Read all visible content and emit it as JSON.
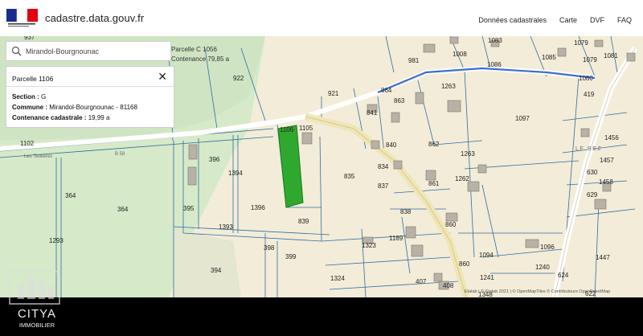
{
  "header": {
    "brand": "cadastre.data.gouv.fr",
    "nav": [
      "Données cadastrales",
      "Carte",
      "DVF",
      "FAQ"
    ]
  },
  "search": {
    "value": "Mirandol-Bourgnounac"
  },
  "tooltip": {
    "line1": "Parcelle C 1056",
    "line2": "Contenance 79,85 a"
  },
  "parcel_panel": {
    "title": "Parcelle 1106",
    "section_label": "Section :",
    "section_value": "G",
    "commune_label": "Commune :",
    "commune_value": "Mirandol-Bourgnounac - 81168",
    "contenance_label": "Contenance cadastrale :",
    "contenance_value": "19,99 a"
  },
  "map": {
    "highlight_color": "#2fa82f",
    "road_labels": [
      "B 58",
      "Les Teulières"
    ],
    "place_label": "LE BEZ",
    "parcel_numbers": [
      "937",
      "981",
      "1008",
      "1083",
      "1085",
      "1079",
      "1081",
      "1086",
      "1080",
      "922",
      "921",
      "864",
      "863",
      "1263",
      "419",
      "841",
      "1097",
      "1102",
      "1106",
      "1105",
      "840",
      "862",
      "1456",
      "396",
      "1394",
      "835",
      "834",
      "1262",
      "1457",
      "861",
      "630",
      "837",
      "1458",
      "629",
      "364",
      "364",
      "395",
      "1396",
      "838",
      "839",
      "860",
      "1323",
      "1189",
      "1293",
      "1393",
      "398",
      "399",
      "1096",
      "1447",
      "394",
      "1094",
      "860",
      "1240",
      "1324",
      "407",
      "1241",
      "624",
      "408",
      "622",
      "1348"
    ]
  },
  "attribution": "Etalab | © Etalab 2021 | © OpenMapTiles © Contributeurs OpenStreetMap",
  "watermark": {
    "name": "CITYA",
    "sub": "IMMOBILIER"
  }
}
